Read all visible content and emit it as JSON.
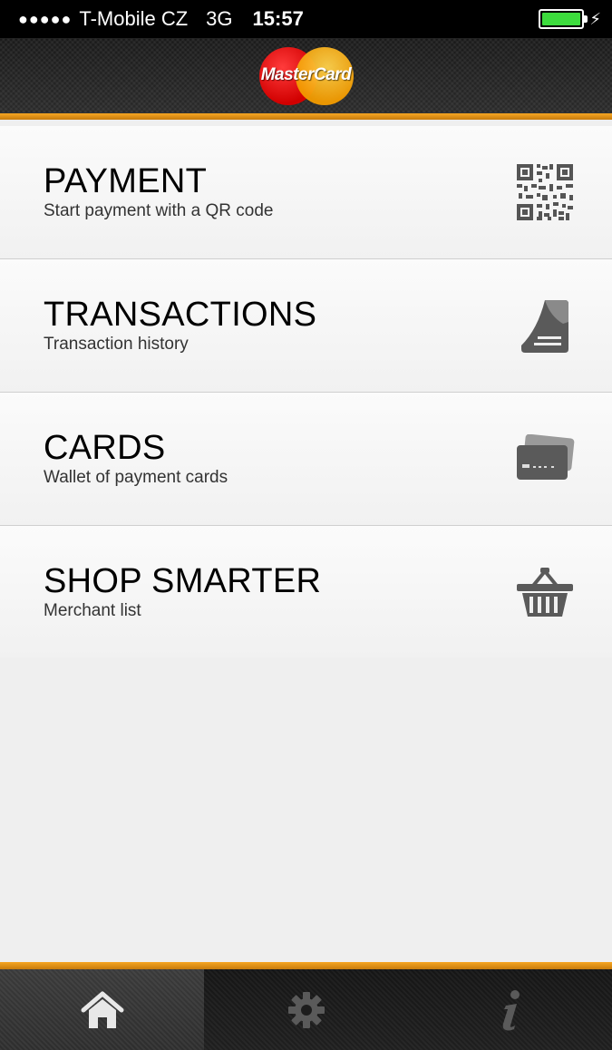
{
  "status_bar": {
    "signal": "●●●●●",
    "carrier": "T-Mobile CZ",
    "network": "3G",
    "time": "15:57",
    "battery_icon": "battery-full-icon",
    "charging_icon": "charging-bolt-icon",
    "charging_glyph": "⚡"
  },
  "header": {
    "logo_text": "MasterCard",
    "accent_color": "#f6a623"
  },
  "menu": {
    "items": [
      {
        "title": "PAYMENT",
        "subtitle": "Start payment with a QR code",
        "icon": "qr-code-icon"
      },
      {
        "title": "TRANSACTIONS",
        "subtitle": "Transaction history",
        "icon": "receipt-icon"
      },
      {
        "title": "CARDS",
        "subtitle": "Wallet of payment cards",
        "icon": "cards-icon"
      },
      {
        "title": "SHOP SMARTER",
        "subtitle": "Merchant list",
        "icon": "basket-icon"
      }
    ]
  },
  "tabbar": {
    "tabs": [
      {
        "icon": "home-icon",
        "active": true
      },
      {
        "icon": "gear-icon",
        "active": false
      },
      {
        "icon": "info-icon",
        "active": false
      }
    ]
  }
}
